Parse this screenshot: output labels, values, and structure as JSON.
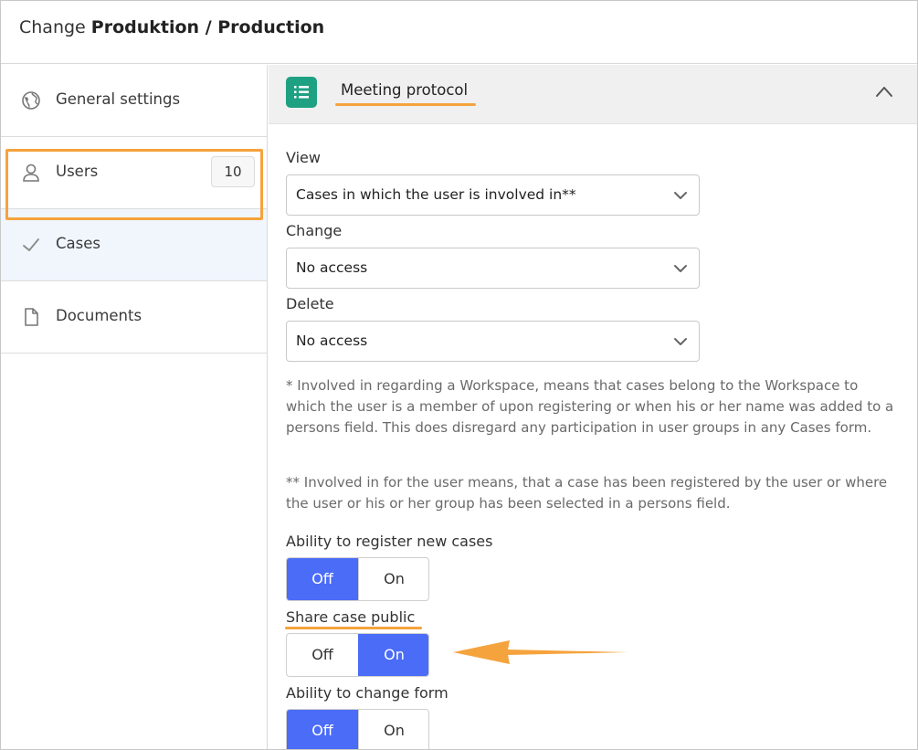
{
  "header": {
    "title_prefix": "Change",
    "title_bold": "Produktion / Production"
  },
  "sidebar": {
    "items": [
      {
        "label": "General settings",
        "icon": "globe-icon"
      },
      {
        "label": "Users",
        "icon": "user-icon",
        "count": "10"
      },
      {
        "label": "Cases",
        "icon": "check-icon",
        "active": true
      },
      {
        "label": "Documents",
        "icon": "document-icon"
      }
    ]
  },
  "section": {
    "title": "Meeting protocol",
    "icon": "list-icon",
    "accent": "#1ea182"
  },
  "permissions": {
    "view": {
      "label": "View",
      "value": "Cases in which the user is involved in**"
    },
    "change": {
      "label": "Change",
      "value": "No access"
    },
    "delete": {
      "label": "Delete",
      "value": "No access"
    }
  },
  "notes": {
    "note1": "* Involved in regarding a Workspace, means that cases belong to the Workspace to which the user is a member of upon registering or when his or her name was added to a persons field. This does disregard any participation in user groups in any Cases form.",
    "note2": "** Involved in for the user means, that a case has been registered by the user or where the user or his or her group has been selected in a persons field."
  },
  "toggles": [
    {
      "label": "Ability to register new cases",
      "off_label": "Off",
      "on_label": "On",
      "value": "Off"
    },
    {
      "label": "Share case public",
      "off_label": "Off",
      "on_label": "On",
      "value": "On"
    },
    {
      "label": "Ability to change form",
      "off_label": "Off",
      "on_label": "On",
      "value": "Off"
    }
  ],
  "colors": {
    "toggle_selected": "#4a6cf7",
    "highlight": "#f5a33d"
  }
}
